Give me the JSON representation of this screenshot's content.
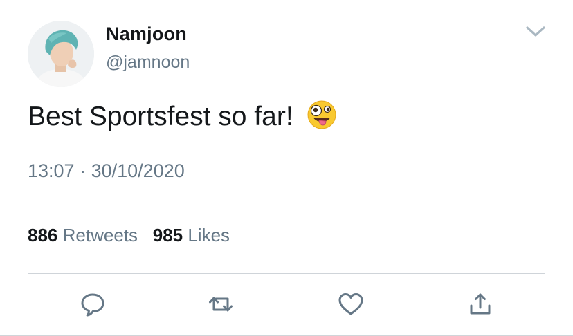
{
  "author": {
    "name": "Namjoon",
    "handle": "@jamnoon",
    "avatar_icon": "profile-photo"
  },
  "tweet": {
    "text": "Best Sportsfest so far!",
    "emoji": "zany-face-emoji",
    "time": "13:07",
    "separator": "·",
    "date": "30/10/2020"
  },
  "stats": {
    "retweets_count": "886",
    "retweets_label": "Retweets",
    "likes_count": "985",
    "likes_label": "Likes"
  },
  "actions": [
    {
      "name": "reply",
      "icon": "speech-bubble-icon"
    },
    {
      "name": "retweet",
      "icon": "retweet-arrows-icon"
    },
    {
      "name": "like",
      "icon": "heart-icon"
    },
    {
      "name": "share",
      "icon": "share-upload-icon"
    }
  ],
  "colors": {
    "text_primary": "#14171a",
    "text_secondary": "#657786",
    "icon_gray": "#657786",
    "divider": "#cfd4d9",
    "avatar_hair": "#5fb3b3"
  }
}
